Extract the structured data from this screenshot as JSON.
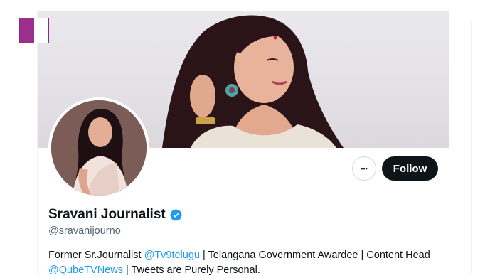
{
  "profile": {
    "display_name": "Sravani Journalist",
    "handle": "@sravanijourno",
    "verified": true,
    "bio": {
      "part1": "Former Sr.Journalist ",
      "mention1": "@Tv9telugu",
      "part2": " | Telangana Government Awardee | Content Head ",
      "mention2": "@QubeTVNews",
      "part3": " | Tweets are Purely Personal."
    }
  },
  "actions": {
    "more_label": "•••",
    "follow_label": "Follow"
  },
  "colors": {
    "accent": "#1d9bf0",
    "follow_bg": "#0f1419",
    "flag_purple": "#9b2f8c"
  },
  "icons": {
    "verified": "verified-badge-icon",
    "more": "more-options-icon",
    "flag": "flag-badge-icon"
  }
}
